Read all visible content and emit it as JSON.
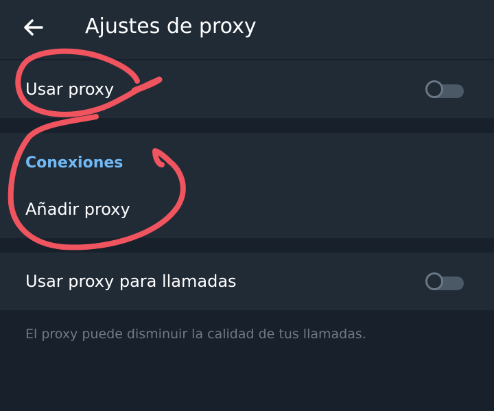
{
  "header": {
    "title": "Ajustes de proxy",
    "back_icon": "arrow-left-icon"
  },
  "proxy_row": {
    "label": "Usar proxy",
    "toggle_on": false
  },
  "connections": {
    "section_title": "Conexiones",
    "add_label": "Añadir proxy"
  },
  "calls_row": {
    "label": "Usar proxy para llamadas",
    "toggle_on": false
  },
  "footnote": "El proxy puede disminuir la calidad de tus llamadas.",
  "colors": {
    "background": "#18212b",
    "surface": "#212b36",
    "accent": "#71baf5",
    "annotation": "#f0545e"
  }
}
